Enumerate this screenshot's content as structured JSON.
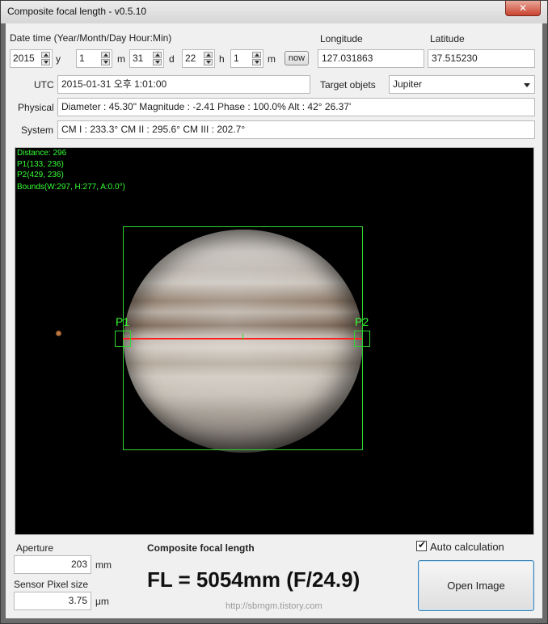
{
  "window": {
    "title": "Composite focal length - v0.5.10",
    "close_glyph": "✕"
  },
  "datetime": {
    "label": "Date time (Year/Month/Day Hour:Min)",
    "year": "2015",
    "y_unit": "y",
    "month": "1",
    "m_unit": "m",
    "day": "31",
    "d_unit": "d",
    "hour": "22",
    "h_unit": "h",
    "minute": "1",
    "min_unit": "m",
    "now_label": "now"
  },
  "location": {
    "longitude_label": "Longitude",
    "longitude": "127.031863",
    "latitude_label": "Latitude",
    "latitude": "37.515230"
  },
  "utc": {
    "label": "UTC",
    "value": "2015-01-31 오후 1:01:00"
  },
  "target": {
    "label": "Target objets",
    "value": "Jupiter"
  },
  "physical": {
    "label": "Physical",
    "value": "Diameter : 45.30\"   Magnitude : -2.41   Phase : 100.0%   Alt : 42° 26.37'"
  },
  "system": {
    "label": "System",
    "value": "CM I : 233.3° CM II : 295.6° CM III : 202.7°"
  },
  "overlay": {
    "distance": "Distance: 296",
    "p1": "P1(133, 236)",
    "p2": "P2(429, 236)",
    "bounds": "Bounds(W:297, H:277, A:0.0°)",
    "p1_label": "P1",
    "p2_label": "P2"
  },
  "aperture": {
    "label": "Aperture",
    "value": "203",
    "unit": "mm"
  },
  "sensor": {
    "label": "Sensor Pixel size",
    "value": "3.75",
    "unit": "μm"
  },
  "result": {
    "heading": "Composite focal length",
    "value": "FL = 5054mm (F/24.9)",
    "url": "http://sbrngm.tistory.com"
  },
  "auto_calc": {
    "label": "Auto calculation",
    "checked": true,
    "check_glyph": "✔"
  },
  "open_image_label": "Open Image",
  "colors": {
    "overlay_green": "#35ff35",
    "measure_red": "#ff1d1d",
    "accent_blue": "#3c7fb1"
  }
}
